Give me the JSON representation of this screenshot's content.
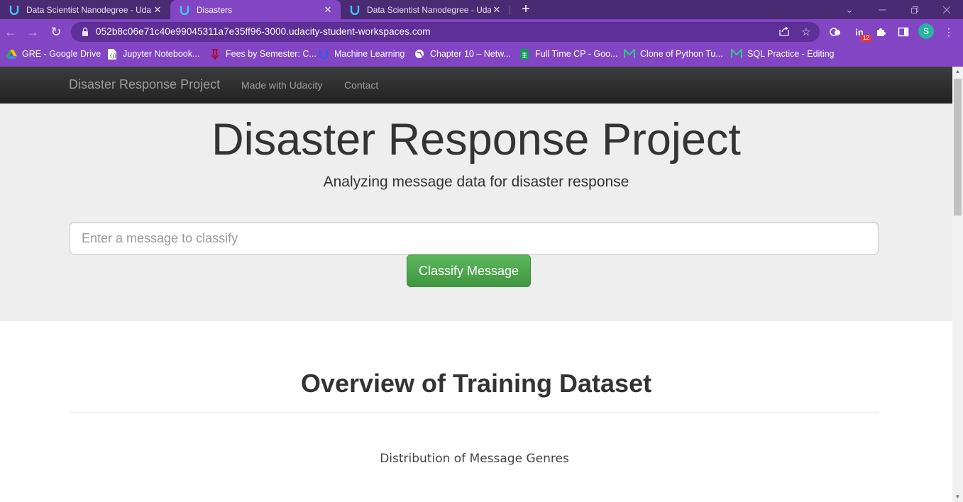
{
  "browser": {
    "tabs": [
      {
        "title": "Data Scientist Nanodegree - Uda",
        "active": false
      },
      {
        "title": "Disasters",
        "active": true
      },
      {
        "title": "Data Scientist Nanodegree - Uda",
        "active": false
      }
    ],
    "new_tab": "+",
    "url": "052b8c06e71c40e99045311a7e35ff96-3000.udacity-student-workspaces.com",
    "profile_initial": "S",
    "extension_badge": "12",
    "bookmarks": [
      {
        "label": "GRE - Google Drive",
        "icon": "google-drive-icon"
      },
      {
        "label": "Jupyter Notebook...",
        "icon": "jupyter-icon"
      },
      {
        "label": "Fees by Semester: C...",
        "icon": "university-icon"
      },
      {
        "label": "Machine Learning",
        "icon": "udacity-icon"
      },
      {
        "label": "Chapter 10 – Netw...",
        "icon": "globe-icon"
      },
      {
        "label": "Full Time CP - Goo...",
        "icon": "google-sheets-icon"
      },
      {
        "label": "Clone of Python Tu...",
        "icon": "bookmark-m-icon"
      },
      {
        "label": "SQL Practice - Editing",
        "icon": "bookmark-m-icon"
      }
    ],
    "colors": {
      "tabstrip": "#4a2a72",
      "toolbar": "#8245c4",
      "omnibox": "#5d2f97"
    }
  },
  "page": {
    "navbar": {
      "brand": "Disaster Response Project",
      "links": [
        "Made with Udacity",
        "Contact"
      ]
    },
    "hero": {
      "title": "Disaster Response Project",
      "subtitle": "Analyzing message data for disaster response",
      "input_placeholder": "Enter a message to classify",
      "button_label": "Classify Message"
    },
    "overview": {
      "heading": "Overview of Training Dataset",
      "plot_title": "Distribution of Message Genres"
    },
    "colors": {
      "navbar": "#222222",
      "jumbotron": "#eeeeee",
      "button": "#5cb85c"
    }
  }
}
